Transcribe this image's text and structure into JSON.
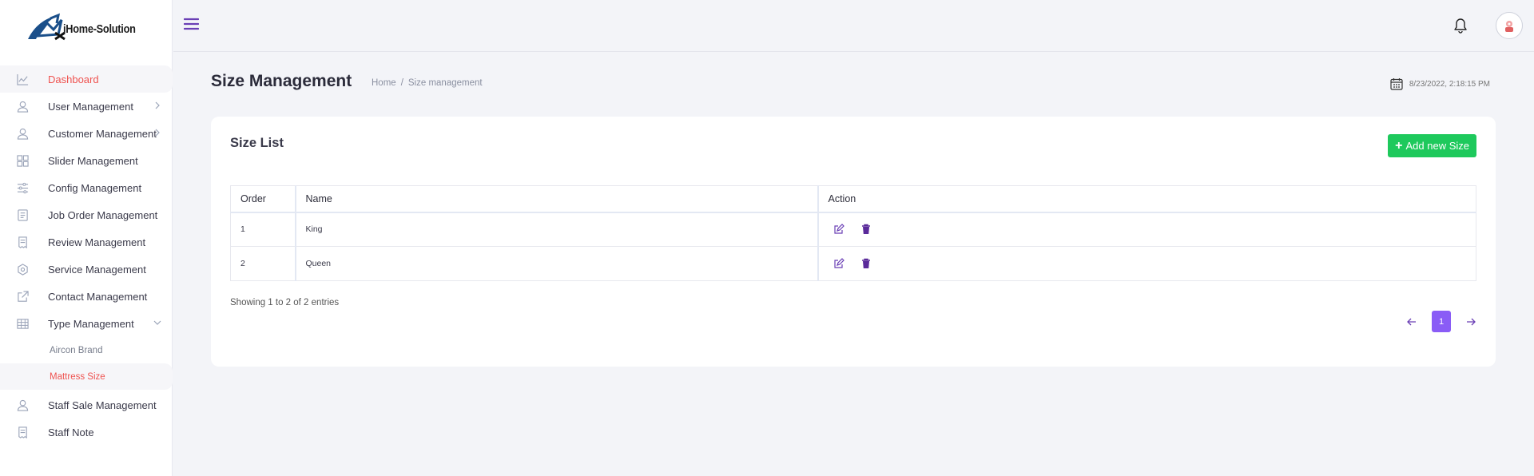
{
  "app": {
    "logo_text": "iHome-Solution"
  },
  "sidebar": {
    "items": [
      {
        "label": "Dashboard",
        "icon": "chart-line-icon",
        "active": true
      },
      {
        "label": "User Management",
        "icon": "user-icon",
        "expandable": true
      },
      {
        "label": "Customer Management",
        "icon": "user-icon",
        "expandable": true
      },
      {
        "label": "Slider Management",
        "icon": "grid-icon"
      },
      {
        "label": "Config Management",
        "icon": "sliders-icon"
      },
      {
        "label": "Job Order Management",
        "icon": "document-icon"
      },
      {
        "label": "Review Management",
        "icon": "receipt-icon"
      },
      {
        "label": "Service Management",
        "icon": "hexagon-gear-icon"
      },
      {
        "label": "Contact Management",
        "icon": "external-link-icon"
      },
      {
        "label": "Type Management",
        "icon": "table-icon",
        "expanded": true
      }
    ],
    "sub_items": [
      {
        "label": "Aircon Brand"
      },
      {
        "label": "Mattress Size",
        "active": true
      }
    ],
    "bottom_items": [
      {
        "label": "Staff Sale Management",
        "icon": "user-icon"
      },
      {
        "label": "Staff Note",
        "icon": "receipt-icon"
      }
    ]
  },
  "header": {
    "title": "Size Management",
    "breadcrumb": {
      "home": "Home",
      "separator": "/",
      "current": "Size management"
    },
    "datetime": "8/23/2022, 2:18:15 PM"
  },
  "card": {
    "title": "Size List",
    "add_button": "Add new Size",
    "table": {
      "columns": [
        "Order",
        "Name",
        "Action"
      ],
      "rows": [
        {
          "order": "1",
          "name": "King"
        },
        {
          "order": "2",
          "name": "Queen"
        }
      ]
    },
    "showing": "Showing 1 to 2 of 2 entries",
    "pagination": {
      "current_page": "1"
    }
  },
  "colors": {
    "accent_active": "#ef5350",
    "primary_button": "#1ec95c",
    "pagination_active": "#8a5cf6",
    "icon_purple": "#6a3fb5"
  }
}
